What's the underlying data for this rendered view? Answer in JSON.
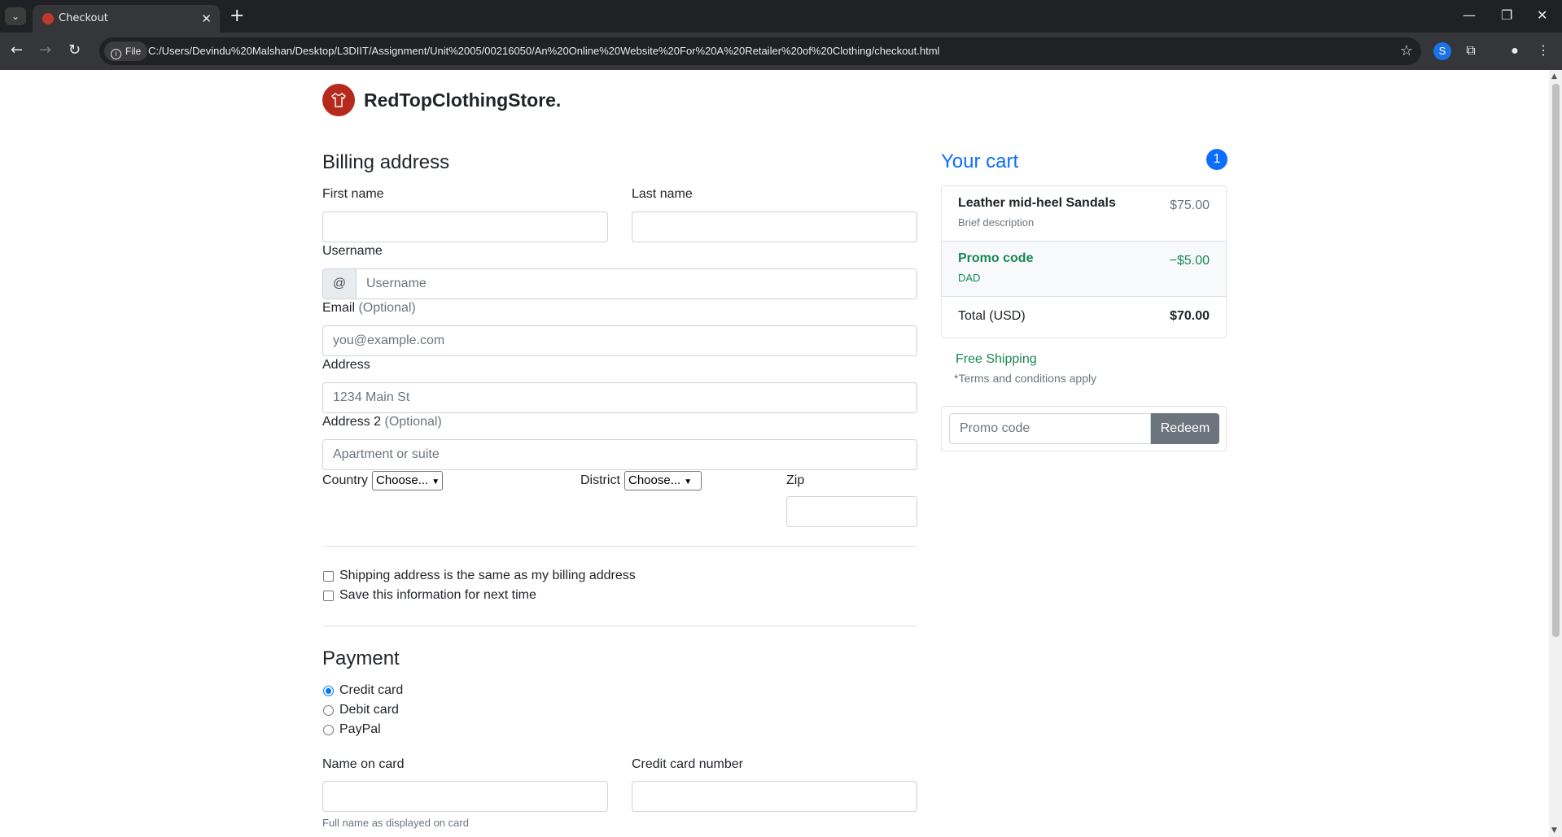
{
  "browser": {
    "tab_title": "Checkout",
    "file_chip": "File",
    "url": "C:/Users/Devindu%20Malshan/Desktop/L3DIIT/Assignment/Unit%2005/00216050/An%20Online%20Website%20For%20A%20Retailer%20of%20Clothing/checkout.html"
  },
  "header": {
    "brand": "RedTopClothingStore."
  },
  "billing": {
    "title": "Billing address",
    "first_name_label": "First name",
    "last_name_label": "Last name",
    "username_label": "Username",
    "username_addon": "@",
    "username_placeholder": "Username",
    "email_label": "Email",
    "email_optional": "(Optional)",
    "email_placeholder": "you@example.com",
    "address_label": "Address",
    "address_placeholder": "1234 Main St",
    "address2_label": "Address 2",
    "address2_optional": "(Optional)",
    "address2_placeholder": "Apartment or suite",
    "country_label": "Country",
    "country_selected": "Choose...",
    "district_label": "District",
    "district_selected": "Choose...",
    "zip_label": "Zip",
    "same_address_label": "Shipping address is the same as my billing address",
    "save_info_label": "Save this information for next time"
  },
  "payment": {
    "title": "Payment",
    "methods": [
      {
        "label": "Credit card",
        "checked": true
      },
      {
        "label": "Debit card",
        "checked": false
      },
      {
        "label": "PayPal",
        "checked": false
      }
    ],
    "name_on_card_label": "Name on card",
    "name_on_card_help": "Full name as displayed on card",
    "card_number_label": "Credit card number"
  },
  "cart": {
    "title": "Your cart",
    "count": "1",
    "items": [
      {
        "name": "Leather mid-heel Sandals",
        "desc": "Brief description",
        "price": "$75.00"
      }
    ],
    "promo": {
      "name": "Promo code",
      "code": "DAD",
      "amount": "−$5.00"
    },
    "total_label": "Total (USD)",
    "total_value": "$70.00",
    "free_shipping": "Free Shipping",
    "terms": "*Terms and conditions apply",
    "promo_placeholder": "Promo code",
    "redeem_label": "Redeem"
  },
  "colors": {
    "accent": "#0d6efd",
    "success": "#198754",
    "brand": "#b52a1c",
    "secondary": "#6c757d"
  }
}
